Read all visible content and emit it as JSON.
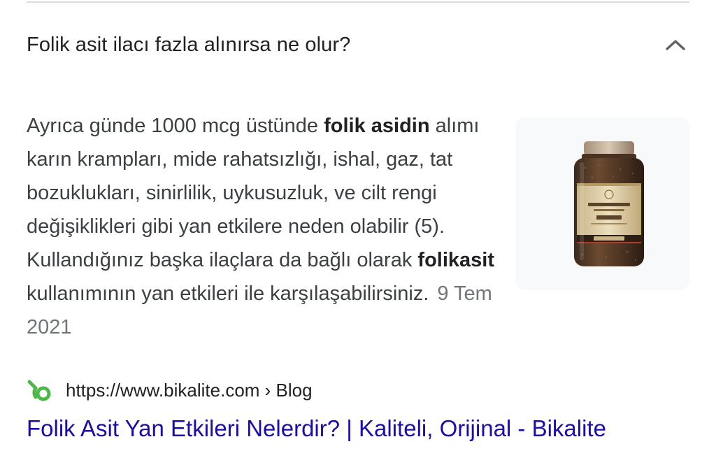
{
  "faq": {
    "question": "Folik asit ilacı fazla alınırsa ne olur?",
    "chevron_icon": "chevron-up-icon",
    "answer": {
      "seg1": "Ayrıca günde 1000 mcg üstünde ",
      "bold1": "folik asidin",
      "seg2": " alımı karın krampları, mide rahatsızlığı, ishal, gaz, tat bozuklukları, sinirlilik, uykusuzluk, ve cilt rengi değişiklikleri gibi yan etkilere neden olabilir (5). Kullandığınız başka ilaçlara da bağlı olarak ",
      "bold2": "folikasit",
      "seg3": " kullanımının yan etkileri ile karşılaşabilirsiniz.",
      "date": "9 Tem 2021"
    },
    "thumbnail_icon": "supplement-bottle-image"
  },
  "source": {
    "favicon_icon": "bikalite-logo-icon",
    "url": "https://www.bikalite.com › Blog"
  },
  "result": {
    "title": "Folik Asit Yan Etkileri Nelerdir? | Kaliteli, Orijinal - Bikalite"
  },
  "colors": {
    "link": "#1a0dab",
    "text": "#202124",
    "muted": "#70757a",
    "favicon_green": "#4cb848"
  }
}
